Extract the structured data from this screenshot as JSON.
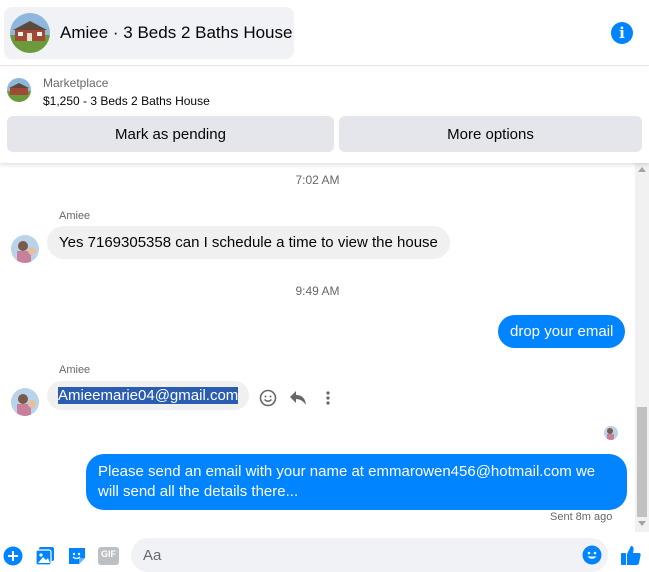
{
  "header": {
    "title": "Amiee · 3 Beds 2 Baths House",
    "info_icon": "info-icon"
  },
  "marketplace": {
    "label": "Marketplace",
    "listing": "$1,250 - 3 Beds 2 Baths House",
    "mark_pending_label": "Mark as pending",
    "more_options_label": "More options"
  },
  "messages": {
    "time1": "7:02 AM",
    "sender1": "Amiee",
    "msg1": "Yes 7169305358 can I schedule a time to view the house",
    "time2": "9:49 AM",
    "msg2": "drop your email",
    "sender2": "Amiee",
    "msg3": "Amieemarie04@gmail.com",
    "msg4": "Please send an email with your name at emmarowen456@hotmail.com we will send all the details there...",
    "sent_status": "Sent 8m ago"
  },
  "composer": {
    "placeholder": "Aa",
    "gif_label": "GIF"
  },
  "colors": {
    "accent": "#0084ff",
    "incoming_bubble": "#f0f0f0",
    "button_bg": "#e4e6eb"
  }
}
